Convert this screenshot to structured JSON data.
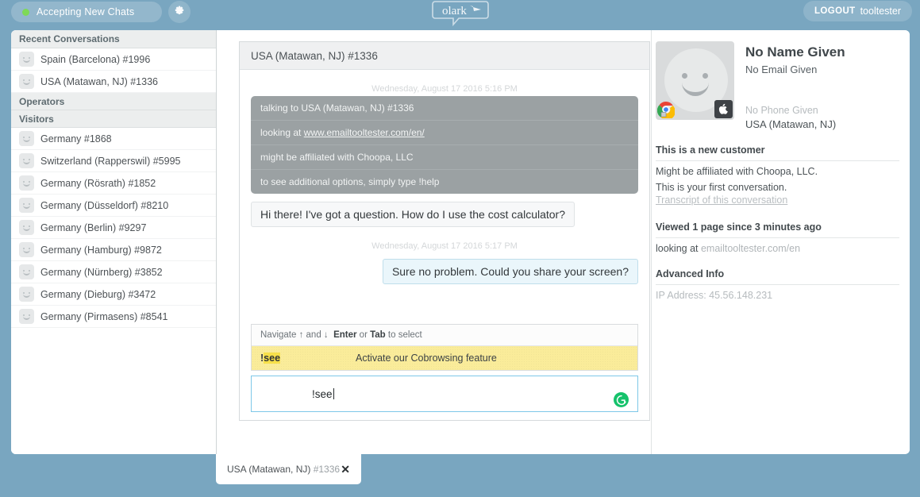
{
  "topbar": {
    "status_label": "Accepting New Chats",
    "status_color": "#7ed957",
    "gear_icon": "gear-icon",
    "logo_text": "olark",
    "logout_label": "LOGOUT",
    "username": "tooltester",
    "bar_color": "#79a6c0"
  },
  "sidebar": {
    "sections": [
      {
        "header": "Recent Conversations",
        "items": [
          {
            "label": "Spain (Barcelona) #1996"
          },
          {
            "label": "USA (Matawan, NJ) #1336"
          }
        ]
      },
      {
        "header": "Operators",
        "items": []
      },
      {
        "header": "Visitors",
        "items": [
          {
            "label": "Germany #1868"
          },
          {
            "label": "Switzerland (Rapperswil) #5995"
          },
          {
            "label": "Germany (Rösrath) #1852"
          },
          {
            "label": "Germany (Düsseldorf) #8210"
          },
          {
            "label": "Germany (Berlin) #9297"
          },
          {
            "label": "Germany (Hamburg) #9872"
          },
          {
            "label": "Germany (Nürnberg) #3852"
          },
          {
            "label": "Germany (Dieburg) #3472"
          },
          {
            "label": "Germany (Pirmasens) #8541"
          }
        ]
      }
    ]
  },
  "chat": {
    "title": "USA (Matawan, NJ) #1336",
    "timestamp_1": "Wednesday, August 17 2016 5:16 PM",
    "system_rows": [
      {
        "text": "talking to USA (Matawan, NJ) #1336"
      },
      {
        "pre": "looking at ",
        "link": "www.emailtooltester.com/en/"
      },
      {
        "text": "might be affiliated with Choopa, LLC"
      },
      {
        "text": "to see additional options, simply type !help"
      }
    ],
    "visitor_message": "Hi there! I've got a question. How do I use the cost calculator?",
    "timestamp_2": "Wednesday, August 17 2016 5:17 PM",
    "operator_message": "Sure no problem. Could you share your screen?"
  },
  "composer": {
    "hint_pre": "Navigate ↑ and ↓",
    "hint_enter": "Enter",
    "hint_or": "or",
    "hint_tab": "Tab",
    "hint_post": "to select",
    "suggestion_cmd_prefix": "!",
    "suggestion_cmd_highlight": "see",
    "suggestion_desc": "Activate our Cobrowsing feature",
    "input_value": "!see",
    "input_placeholder": "",
    "grammarly_icon": "grammarly-icon",
    "highlight_color": "#f7e04a",
    "row_color": "#faec9a",
    "focus_border": "#7ec8e8"
  },
  "visitor": {
    "name": "No Name Given",
    "email": "No Email Given",
    "phone": "No Phone Given",
    "location": "USA (Matawan, NJ)",
    "browser_icon": "chrome-icon",
    "os_icon": "apple-icon",
    "sections": [
      {
        "title": "This is a new customer",
        "lines": [
          "Might be affiliated with Choopa, LLC.",
          "This is your first conversation."
        ],
        "link": "Transcript of this conversation"
      },
      {
        "title": "Viewed 1 page since 3 minutes ago",
        "looking_at_label": "looking at ",
        "looking_at_url": "emailtooltester.com/en"
      },
      {
        "title": "Advanced Info",
        "ip_label": "IP Address: 45.56.148.231"
      }
    ]
  },
  "bottom_tab": {
    "label": "USA (Matawan, NJ) ",
    "number": "#1336",
    "close_icon": "✕"
  }
}
